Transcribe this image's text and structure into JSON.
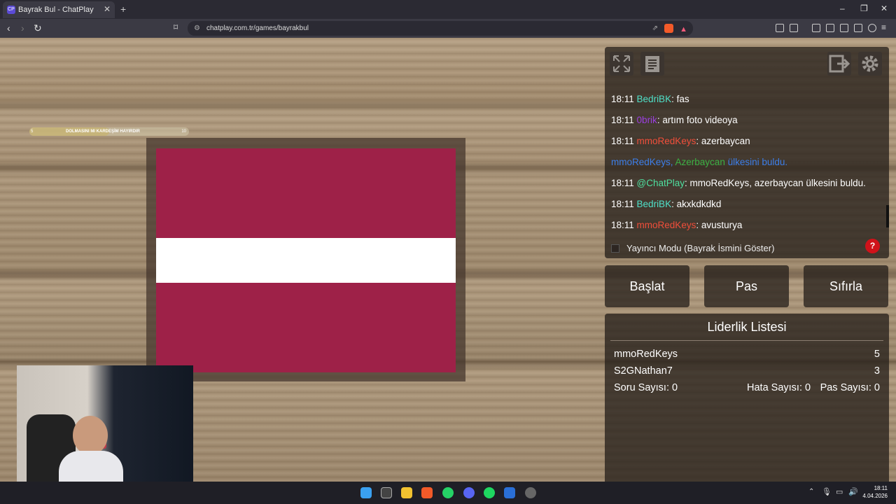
{
  "browser": {
    "tab_title": "Bayrak Bul - ChatPlay",
    "tab_favicon": "CP",
    "url": "chatplay.com.tr/games/bayrakbul"
  },
  "game": {
    "progress_left": "5",
    "progress_text": "DOLMASINI MI KARDEŞİM HAYIRDIR",
    "progress_right": "10",
    "progress_fraction": 0.5,
    "flag_colors": [
      "#9e2148",
      "#ffffff",
      "#9e2148"
    ],
    "flag_stripe_ratios": [
      2,
      1,
      2
    ]
  },
  "chat": {
    "messages": [
      {
        "time": "18:11",
        "user": "BedriBK",
        "user_color": "#4fe0c8",
        "text": ": fas"
      },
      {
        "time": "18:11",
        "user": "0brik",
        "user_color": "#9b3fe0",
        "text": ": artım foto videoya"
      },
      {
        "time": "18:11",
        "user": "mmoRedKeys",
        "user_color": "#f04e3a",
        "text": ": azerbaycan"
      },
      {
        "time": "",
        "user": "mmoRedKeys,",
        "user_color": "#3c7ee8",
        "text": " Azerbaycan",
        "text2": " ülkesini buldu.",
        "is_system": true
      },
      {
        "time": "18:11",
        "user": "@ChatPlay",
        "user_color": "#4fe0a0",
        "text": ": mmoRedKeys, azerbaycan ülkesini buldu."
      },
      {
        "time": "18:11",
        "user": "BedriBK",
        "user_color": "#4fe0c8",
        "text": ": akxkdkdkd"
      },
      {
        "time": "18:11",
        "user": "mmoRedKeys",
        "user_color": "#f04e3a",
        "text": ": avusturya"
      }
    ],
    "streamer_mode_label": "Yayıncı Modu (Bayrak İsmini Göster)",
    "help_label": "?"
  },
  "buttons": {
    "start": "Başlat",
    "pass": "Pas",
    "reset": "Sıfırla"
  },
  "leaderboard": {
    "title": "Liderlik Listesi",
    "entries": [
      {
        "name": "mmoRedKeys",
        "score": "5"
      },
      {
        "name": "S2GNathan7",
        "score": "3"
      }
    ],
    "question_count": "Soru Sayısı: 0",
    "error_count": "Hata Sayısı: 0",
    "pass_count": "Pas Sayısı: 0"
  },
  "taskbar": {
    "time": "18:11",
    "date": "4.04.2026"
  }
}
